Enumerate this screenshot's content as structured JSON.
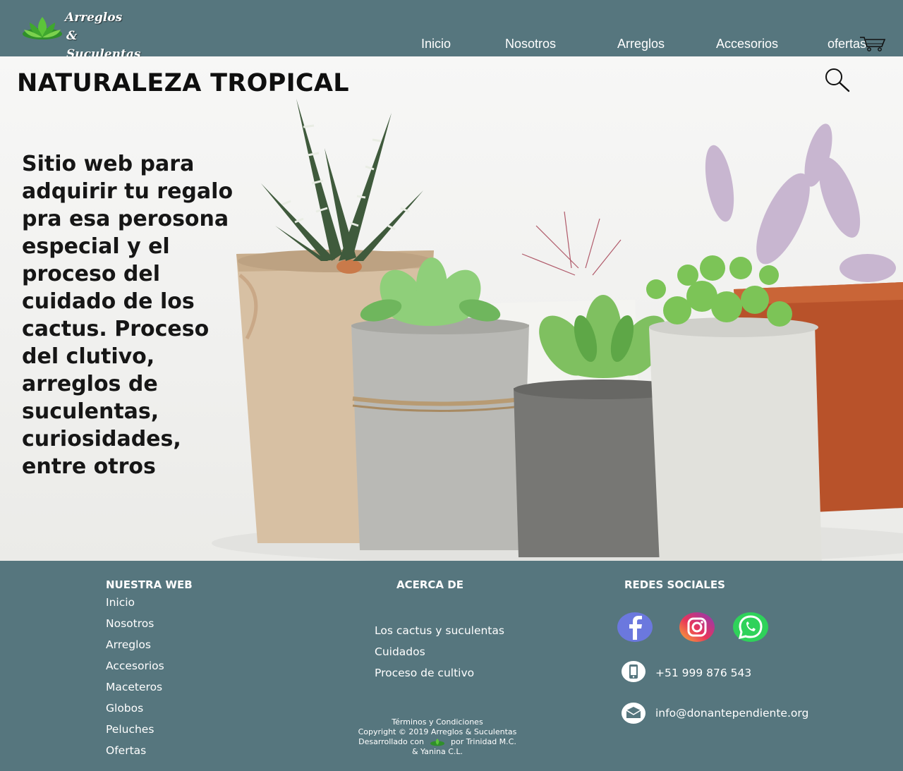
{
  "brand": {
    "line1": "Arreglos",
    "line2": "& Suculentas",
    "logo_icon": "lotus-leaves-icon"
  },
  "nav": {
    "items": [
      {
        "label": "Inicio"
      },
      {
        "label": "Nosotros"
      },
      {
        "label": "Arreglos"
      },
      {
        "label": "Accesorios"
      },
      {
        "label": "ofertas"
      }
    ],
    "cart_icon": "shopping-cart-icon"
  },
  "hero": {
    "title": "NATURALEZA TROPICAL",
    "description": "Sitio web para adquirir tu regalo pra esa perosona especial y el proceso del cuidado de los cactus. Proceso del clutivo, arreglos de suculentas, curiosidades, entre otros",
    "search_icon": "magnifier-icon",
    "image": "potted-succulents-photo"
  },
  "footer": {
    "col1": {
      "heading": "NUESTRA WEB",
      "links": [
        "Inicio",
        "Nosotros",
        "Arreglos",
        "Accesorios",
        "Maceteros",
        "Globos",
        "Peluches",
        "Ofertas"
      ]
    },
    "col2": {
      "heading": "ACERCA DE",
      "links": [
        "Los cactus y suculentas",
        "Cuidados",
        "Proceso de cultivo"
      ]
    },
    "col3": {
      "heading": "REDES SOCIALES",
      "social": [
        "facebook-icon",
        "instagram-icon",
        "whatsapp-icon"
      ],
      "phone": "+51 999 876 543",
      "email": "info@donantependiente.org"
    },
    "legal": {
      "terms": "Términos y Condiciones",
      "copyright": "Copyright © 2019 Arreglos & Suculentas",
      "dev_prefix": "Desarrollado con",
      "dev_suffix": "por Trinidad M.C.",
      "dev_line2": "& Yanina C.L."
    }
  },
  "colors": {
    "header_bg": "#56767e",
    "footer_bg": "#56767e",
    "text_dark": "#161616"
  }
}
